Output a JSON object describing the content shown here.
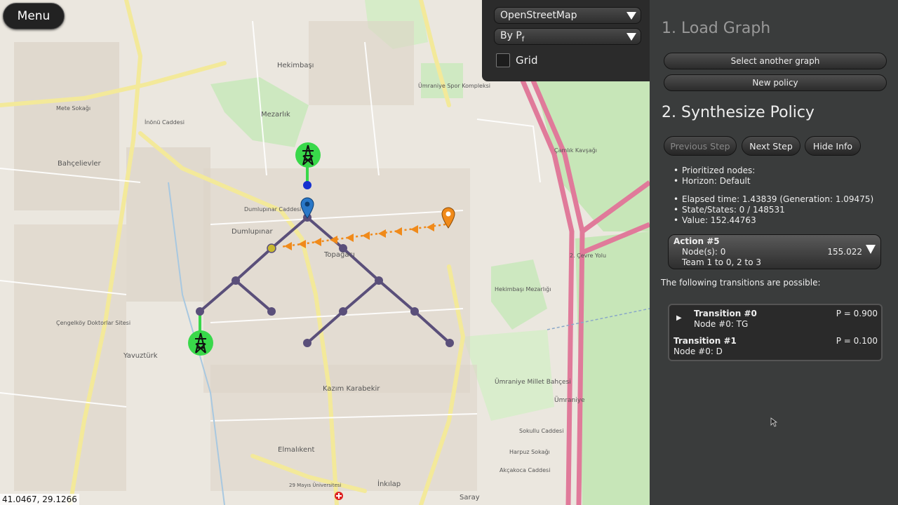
{
  "map": {
    "menu_label": "Menu",
    "coordinates": "41.0467, 29.1266",
    "tile_source": "OpenStreetMap",
    "color_mode": "By P",
    "color_mode_subscript": "f",
    "grid_label": "Grid",
    "grid_checked": false,
    "place_labels": [
      "Hekimbaşı",
      "Bahçelievler",
      "Mezarlık",
      "Dumlupınar",
      "Topağacı",
      "Yavuztürk",
      "Kazım Karabekir",
      "Elmalıkent",
      "Ümraniye Millet Bahçesi",
      "Hekimbaşı Mezarlığı",
      "Çengelköy Doktorlar Sitesi",
      "Ümraniye Spor Kompleksi",
      "Saray",
      "İnkılap",
      "29 Mayıs Üniversitesi",
      "Mete Sokağı",
      "İnönü Caddesi",
      "Dumlupınar Caddesi",
      "Çamlık Kavşağı",
      "Sokullu Caddesi",
      "Harpuz Sokağı",
      "Akçakoca Caddesi",
      "2. Çevre Yolu",
      "Ümraniye"
    ],
    "colors": {
      "edge": "#5a4f7a",
      "tower_bg": "#39d84a",
      "pin_blue": "#2a78c8",
      "pin_orange": "#f08a1a",
      "arrow": "#f08a1a",
      "node_yellow": "#c8b830",
      "motorway": "#e07a9a",
      "park": "#cde8c0"
    }
  },
  "panel": {
    "section1_title": "1. Load Graph",
    "select_graph_label": "Select another graph",
    "new_policy_label": "New policy",
    "section2_title": "2. Synthesize Policy",
    "previous_step_label": "Previous Step",
    "next_step_label": "Next Step",
    "hide_info_label": "Hide Info",
    "info1": [
      "Prioritized nodes:",
      "Horizon: Default"
    ],
    "info2": [
      "Elapsed time: 1.43839 (Generation: 1.09475)",
      "State/States: 0 / 148531",
      "Value: 152.44763"
    ],
    "action": {
      "title": "Action #5",
      "nodes": "Node(s): 0",
      "value": "155.022",
      "team": "Team 1 to 0, 2 to 3"
    },
    "transitions_intro": "The following transitions are possible:",
    "transitions": [
      {
        "title": "Transition #0",
        "node": "Node #0: TG",
        "prob": "P = 0.900"
      },
      {
        "title": "Transition #1",
        "node": "Node #0: D",
        "prob": "P = 0.100"
      }
    ]
  }
}
